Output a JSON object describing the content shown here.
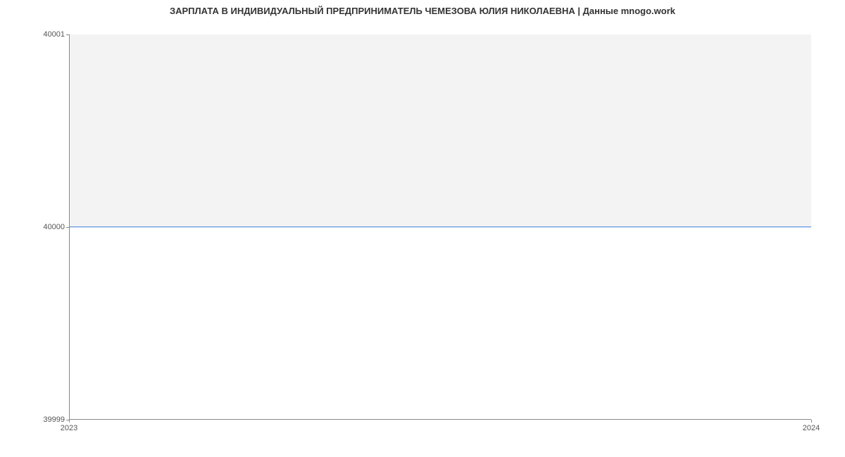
{
  "chart_data": {
    "type": "area",
    "title": "ЗАРПЛАТА В ИНДИВИДУАЛЬНЫЙ ПРЕДПРИНИМАТЕЛЬ ЧЕМЕЗОВА ЮЛИЯ НИКОЛАЕВНА | Данные mnogo.work",
    "x": [
      2023,
      2024
    ],
    "values": [
      40000,
      40000
    ],
    "xlabel": "",
    "ylabel": "",
    "ylim": [
      39999,
      40001
    ],
    "xlim": [
      2023,
      2024
    ],
    "x_ticks": [
      "2023",
      "2024"
    ],
    "y_ticks": [
      "40001",
      "40000",
      "39999"
    ]
  }
}
